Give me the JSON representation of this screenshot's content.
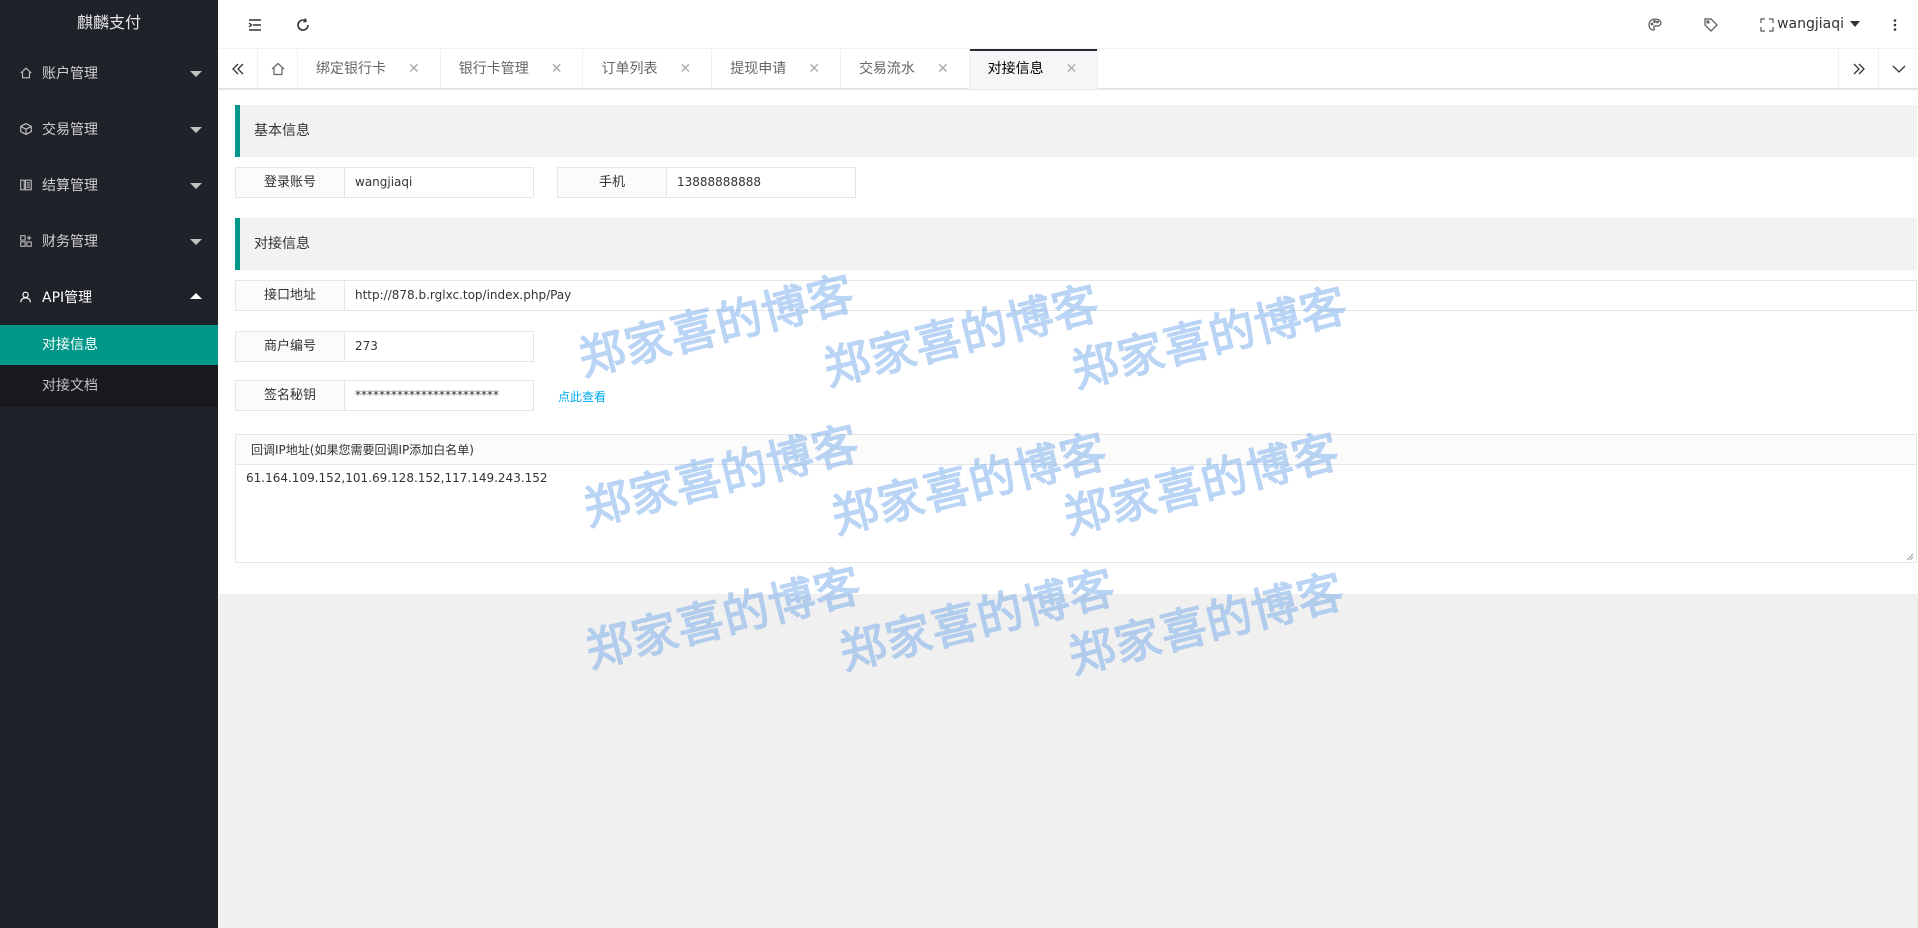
{
  "app": {
    "title": "麒麟支付"
  },
  "sidebar": {
    "items": [
      {
        "label": "账户管理",
        "icon": "home-icon"
      },
      {
        "label": "交易管理",
        "icon": "cube-icon"
      },
      {
        "label": "结算管理",
        "icon": "ledger-icon"
      },
      {
        "label": "财务管理",
        "icon": "finance-icon"
      },
      {
        "label": "API管理",
        "icon": "user-icon"
      }
    ],
    "sub_items": [
      {
        "label": "对接信息"
      },
      {
        "label": "对接文档"
      }
    ]
  },
  "header": {
    "user": "wangjiaqi"
  },
  "tabs": [
    {
      "label": "绑定银行卡"
    },
    {
      "label": "银行卡管理"
    },
    {
      "label": "订单列表"
    },
    {
      "label": "提现申请"
    },
    {
      "label": "交易流水"
    },
    {
      "label": "对接信息"
    }
  ],
  "basic": {
    "title": "基本信息",
    "login_label": "登录账号",
    "login_value": "wangjiaqi",
    "phone_label": "手机",
    "phone_value": "13888888888"
  },
  "integration": {
    "title": "对接信息",
    "api_label": "接口地址",
    "api_value": "http://878.b.rglxc.top/index.php/Pay",
    "merchant_label": "商户编号",
    "merchant_value": "273",
    "secret_label": "签名秘钥",
    "secret_value": "************************",
    "view_link": "点此查看",
    "ip_label": "回调IP地址(如果您需要回调IP添加白名单)",
    "ip_value": "61.164.109.152,101.69.128.152,117.149.243.152"
  },
  "watermark": "郑家喜的博客",
  "colors": {
    "accent": "#009688",
    "sidebar": "#20222a",
    "link": "#01aaed"
  }
}
